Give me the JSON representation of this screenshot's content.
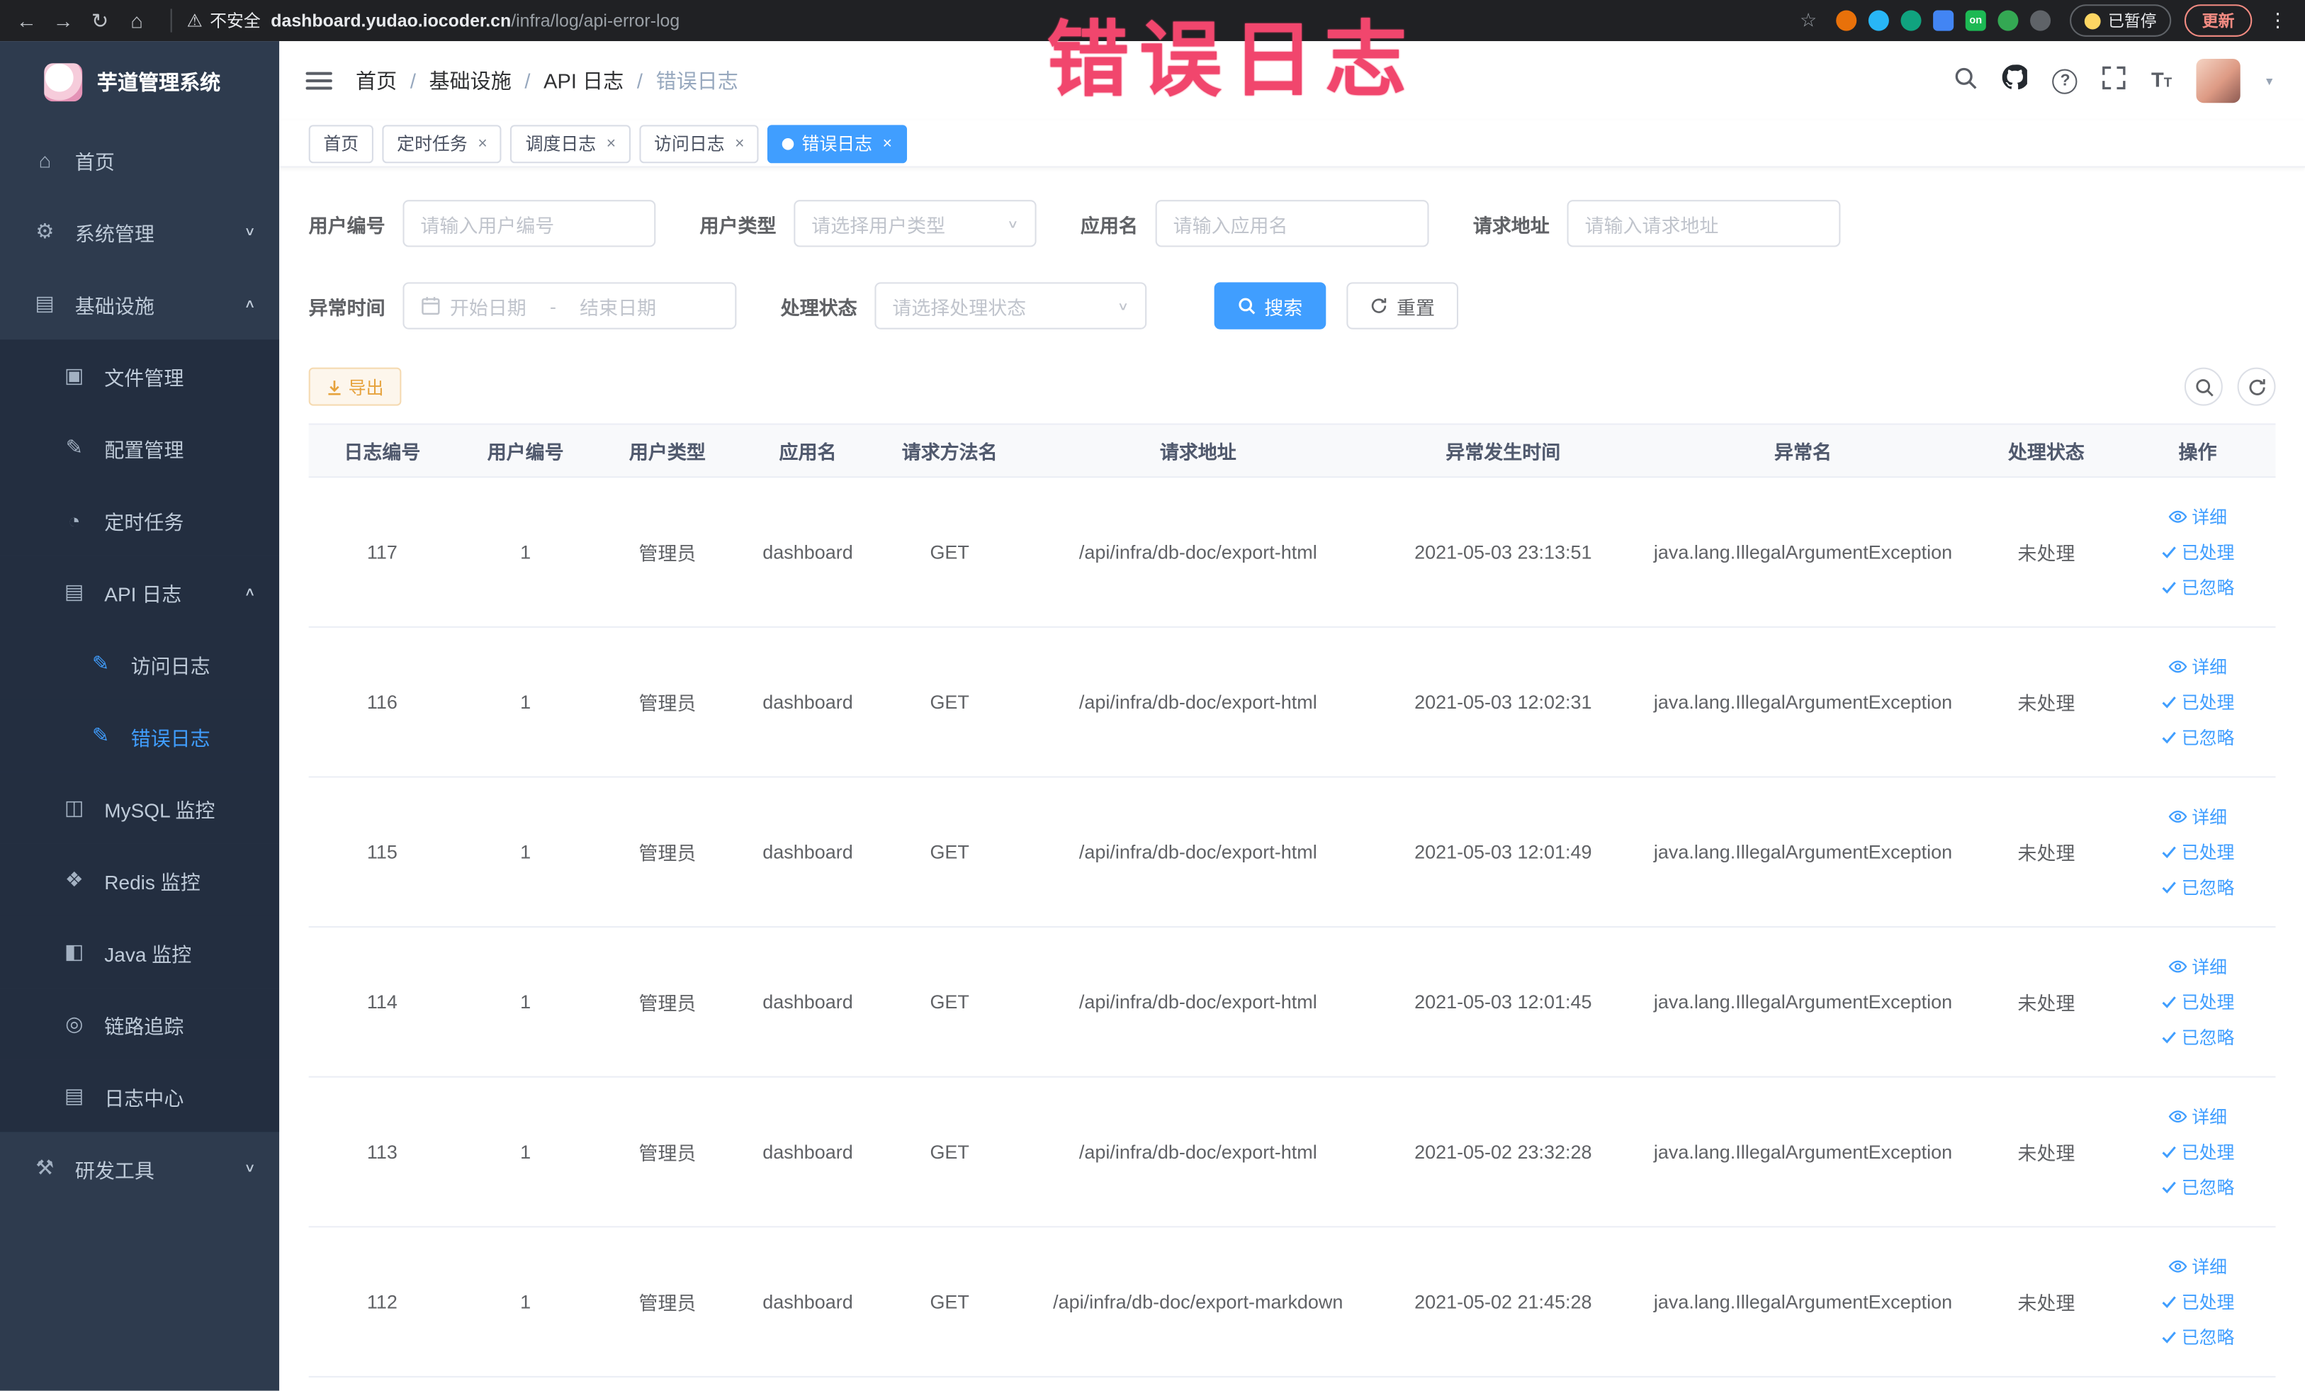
{
  "browser": {
    "security_label": "不安全",
    "url_domain": "dashboard.yudao.iocoder.cn",
    "url_path": "/infra/log/api-error-log",
    "paused_badge": "已暂停",
    "update_button": "更新",
    "extensions": [
      {
        "name": "extension-orange-icon",
        "color": "#e8710a",
        "cls": ""
      },
      {
        "name": "extension-teal-icon",
        "color": "#28b6f6",
        "cls": ""
      },
      {
        "name": "extension-green-circle-icon",
        "color": "#10a37f",
        "cls": ""
      },
      {
        "name": "extension-blue-grid-icon",
        "color": "#4285f4",
        "cls": "grid"
      },
      {
        "name": "extension-on-badge-icon",
        "color": "#1db954",
        "cls": "grid",
        "label": "on"
      },
      {
        "name": "extension-leaf-icon",
        "color": "#34a853",
        "cls": ""
      },
      {
        "name": "extension-puzzle-icon",
        "color": "#5f6368",
        "cls": ""
      }
    ]
  },
  "icons": {
    "back": "←",
    "forward": "→",
    "reload": "↻",
    "home": "⌂",
    "warning": "⚠",
    "star": "☆",
    "kebab": "⋮",
    "close": "×",
    "caret": "▾"
  },
  "annotation": {
    "text": "错误日志",
    "color": "#f1466d"
  },
  "sidebar": {
    "logo_title": "芋道管理系统",
    "items": [
      {
        "label": "首页",
        "glyph": "⌂",
        "icon": "home-icon",
        "cls": "lv1"
      },
      {
        "label": "系统管理",
        "glyph": "⚙",
        "icon": "gear-icon",
        "cls": "lv1",
        "arrow": "∨"
      },
      {
        "label": "基础设施",
        "glyph": "▤",
        "icon": "infrastructure-icon",
        "cls": "lv1",
        "arrow": "∧"
      },
      {
        "label": "文件管理",
        "glyph": "▣",
        "icon": "file-manage-icon",
        "cls": "lv2 sub"
      },
      {
        "label": "配置管理",
        "glyph": "✎",
        "icon": "config-manage-icon",
        "cls": "lv2 sub"
      },
      {
        "label": "定时任务",
        "glyph": "◔",
        "icon": "scheduled-task-icon",
        "cls": "lv2 sub"
      },
      {
        "label": "API 日志",
        "glyph": "▤",
        "icon": "api-log-icon",
        "cls": "lv2 sub",
        "arrow": "∧"
      },
      {
        "label": "访问日志",
        "glyph": "✎",
        "icon": "access-log-icon",
        "cls": "lv3 sub blueicon"
      },
      {
        "label": "错误日志",
        "glyph": "✎",
        "icon": "error-log-icon",
        "cls": "lv3 sub blueicon active"
      },
      {
        "label": "MySQL 监控",
        "glyph": "◫",
        "icon": "mysql-monitor-icon",
        "cls": "lv2 sub"
      },
      {
        "label": "Redis 监控",
        "glyph": "❖",
        "icon": "redis-monitor-icon",
        "cls": "lv2 sub"
      },
      {
        "label": "Java 监控",
        "glyph": "◧",
        "icon": "java-monitor-icon",
        "cls": "lv2 sub"
      },
      {
        "label": "链路追踪",
        "glyph": "◎",
        "icon": "trace-icon",
        "cls": "lv2 sub"
      },
      {
        "label": "日志中心",
        "glyph": "▤",
        "icon": "log-center-icon",
        "cls": "lv2 sub"
      },
      {
        "label": "研发工具",
        "glyph": "⚒",
        "icon": "devtools-icon",
        "cls": "lv1",
        "arrow": "∨"
      }
    ]
  },
  "header": {
    "breadcrumb": {
      "separator": "/",
      "items": [
        {
          "label": "首页",
          "sep": true,
          "cls": ""
        },
        {
          "label": "基础设施",
          "sep": true,
          "cls": ""
        },
        {
          "label": "API 日志",
          "sep": true,
          "cls": ""
        },
        {
          "label": "错误日志",
          "sep": false,
          "cls": "current"
        }
      ]
    }
  },
  "tabs": [
    {
      "label": "首页",
      "closable": false,
      "dot": false,
      "cls": ""
    },
    {
      "label": "定时任务",
      "closable": true,
      "dot": false,
      "cls": ""
    },
    {
      "label": "调度日志",
      "closable": true,
      "dot": false,
      "cls": ""
    },
    {
      "label": "访问日志",
      "closable": true,
      "dot": false,
      "cls": ""
    },
    {
      "label": "错误日志",
      "closable": true,
      "dot": true,
      "cls": "active"
    }
  ],
  "filters": {
    "user_id_label": "用户编号",
    "user_id_placeholder": "请输入用户编号",
    "user_type_label": "用户类型",
    "user_type_placeholder": "请选择用户类型",
    "app_name_label": "应用名",
    "app_name_placeholder": "请输入应用名",
    "request_url_label": "请求地址",
    "request_url_placeholder": "请输入请求地址",
    "exception_time_label": "异常时间",
    "date_start_placeholder": "开始日期",
    "date_separator": "-",
    "date_end_placeholder": "结束日期",
    "process_status_label": "处理状态",
    "process_status_placeholder": "请选择处理状态",
    "search_button": "搜索",
    "reset_button": "重置"
  },
  "toolbar": {
    "export_button": "导出"
  },
  "table": {
    "columns": [
      "日志编号",
      "用户编号",
      "用户类型",
      "应用名",
      "请求方法名",
      "请求地址",
      "异常发生时间",
      "异常名",
      "处理状态",
      "操作"
    ],
    "row_actions": {
      "detail": "详细",
      "processed": "已处理",
      "ignored": "已忽略"
    },
    "rows": [
      {
        "log_id": "117",
        "user_id": "1",
        "user_type": "管理员",
        "app_name": "dashboard",
        "method": "GET",
        "request_url": "/api/infra/db-doc/export-html",
        "time": "2021-05-03 23:13:51",
        "exception": "java.lang.IllegalArgumentException",
        "status": "未处理"
      },
      {
        "log_id": "116",
        "user_id": "1",
        "user_type": "管理员",
        "app_name": "dashboard",
        "method": "GET",
        "request_url": "/api/infra/db-doc/export-html",
        "time": "2021-05-03 12:02:31",
        "exception": "java.lang.IllegalArgumentException",
        "status": "未处理"
      },
      {
        "log_id": "115",
        "user_id": "1",
        "user_type": "管理员",
        "app_name": "dashboard",
        "method": "GET",
        "request_url": "/api/infra/db-doc/export-html",
        "time": "2021-05-03 12:01:49",
        "exception": "java.lang.IllegalArgumentException",
        "status": "未处理"
      },
      {
        "log_id": "114",
        "user_id": "1",
        "user_type": "管理员",
        "app_name": "dashboard",
        "method": "GET",
        "request_url": "/api/infra/db-doc/export-html",
        "time": "2021-05-03 12:01:45",
        "exception": "java.lang.IllegalArgumentException",
        "status": "未处理"
      },
      {
        "log_id": "113",
        "user_id": "1",
        "user_type": "管理员",
        "app_name": "dashboard",
        "method": "GET",
        "request_url": "/api/infra/db-doc/export-html",
        "time": "2021-05-02 23:32:28",
        "exception": "java.lang.IllegalArgumentException",
        "status": "未处理"
      },
      {
        "log_id": "112",
        "user_id": "1",
        "user_type": "管理员",
        "app_name": "dashboard",
        "method": "GET",
        "request_url": "/api/infra/db-doc/export-markdown",
        "time": "2021-05-02 21:45:28",
        "exception": "java.lang.IllegalArgumentException",
        "status": "未处理"
      }
    ]
  }
}
